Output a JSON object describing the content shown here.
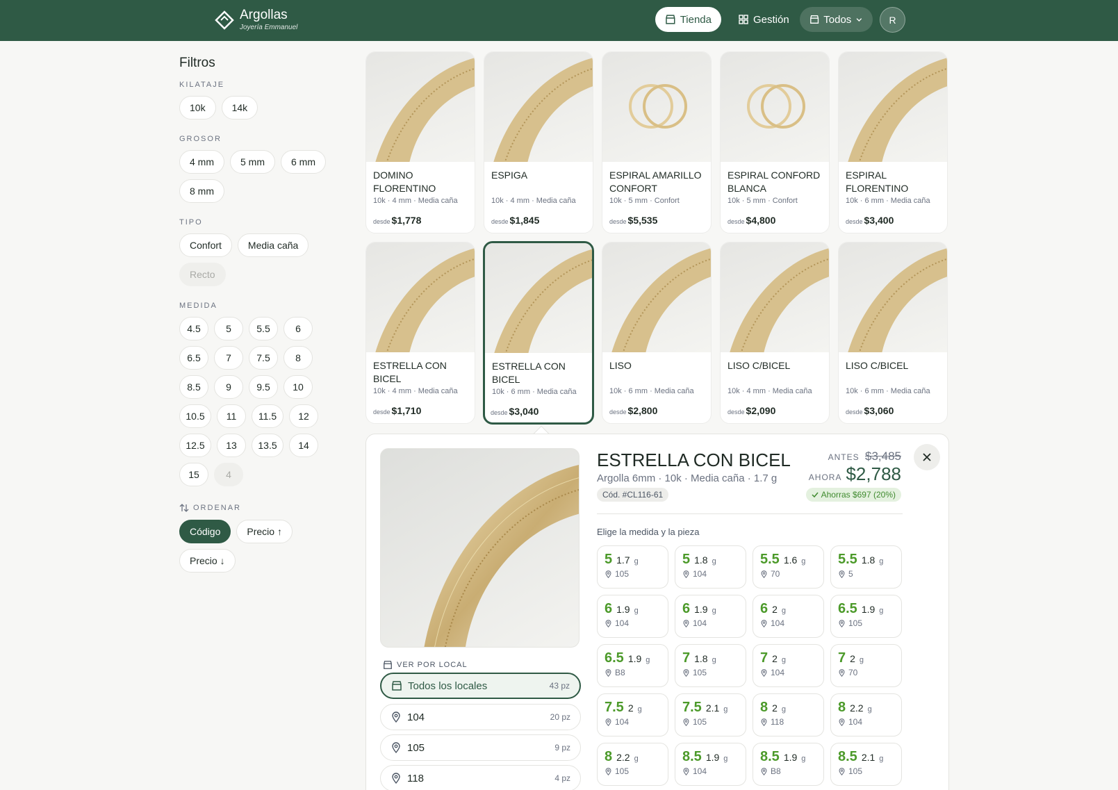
{
  "header": {
    "brand_title": "Argollas",
    "brand_subtitle": "Joyería Emmanuel",
    "nav_tienda": "Tienda",
    "nav_gestion": "Gestión",
    "nav_todos": "Todos",
    "avatar_initial": "R"
  },
  "sidebar": {
    "title": "Filtros",
    "kilataje_label": "KILATAJE",
    "kilataje": [
      "10k",
      "14k"
    ],
    "grosor_label": "GROSOR",
    "grosor": [
      "4 mm",
      "5 mm",
      "6 mm",
      "8 mm"
    ],
    "tipo_label": "TIPO",
    "tipo": [
      "Confort",
      "Media caña",
      "Recto"
    ],
    "medida_label": "MEDIDA",
    "medida": [
      "4.5",
      "5",
      "5.5",
      "6",
      "6.5",
      "7",
      "7.5",
      "8",
      "8.5",
      "9",
      "9.5",
      "10",
      "10.5",
      "11",
      "11.5",
      "12",
      "12.5",
      "13",
      "13.5",
      "14",
      "15",
      "4"
    ],
    "ordenar_label": "ORDENAR",
    "ordenar": [
      "Código",
      "Precio ↑",
      "Precio ↓"
    ]
  },
  "products": [
    {
      "name": "DOMINO FLORENTINO",
      "meta": "10k · 4 mm · Media caña",
      "desde": "desde",
      "price": "$1,778"
    },
    {
      "name": "ESPIGA",
      "meta": "10k · 4 mm · Media caña",
      "desde": "desde",
      "price": "$1,845"
    },
    {
      "name": "ESPIRAL AMARILLO CONFORT",
      "meta": "10k · 5 mm · Confort",
      "desde": "desde",
      "price": "$5,535"
    },
    {
      "name": "ESPIRAL CONFORD BLANCA",
      "meta": "10k · 5 mm · Confort",
      "desde": "desde",
      "price": "$4,800"
    },
    {
      "name": "ESPIRAL FLORENTINO",
      "meta": "10k · 6 mm · Media caña",
      "desde": "desde",
      "price": "$3,400"
    },
    {
      "name": "ESTRELLA CON BICEL",
      "meta": "10k · 4 mm · Media caña",
      "desde": "desde",
      "price": "$1,710"
    },
    {
      "name": "ESTRELLA CON BICEL",
      "meta": "10k · 6 mm · Media caña",
      "desde": "desde",
      "price": "$3,040"
    },
    {
      "name": "LISO",
      "meta": "10k · 6 mm · Media caña",
      "desde": "desde",
      "price": "$2,800"
    },
    {
      "name": "LISO C/BICEL",
      "meta": "10k · 4 mm · Media caña",
      "desde": "desde",
      "price": "$2,090"
    },
    {
      "name": "LISO C/BICEL",
      "meta": "10k · 6 mm · Media caña",
      "desde": "desde",
      "price": "$3,060"
    }
  ],
  "detail": {
    "title": "ESTRELLA CON BICEL",
    "subtitle": "Argolla 6mm · 10k · Media caña · 1.7 g",
    "code": "Cód. #CL116-61",
    "before_label": "ANTES",
    "before_price": "$3,485",
    "now_label": "AHORA",
    "now_price": "$2,788",
    "savings": "Ahorras $697 (20%)",
    "by_local_label": "VER POR LOCAL",
    "locals": [
      {
        "name": "Todos los locales",
        "count": "43 pz"
      },
      {
        "name": "104",
        "count": "20 pz"
      },
      {
        "name": "105",
        "count": "9 pz"
      },
      {
        "name": "118",
        "count": "4 pz"
      }
    ],
    "pick_label": "Elige la medida y la pieza",
    "weight_unit": "g",
    "pieces": [
      {
        "size": "5",
        "weight": "1.7",
        "loc": "105"
      },
      {
        "size": "5",
        "weight": "1.8",
        "loc": "104"
      },
      {
        "size": "5.5",
        "weight": "1.6",
        "loc": "70"
      },
      {
        "size": "5.5",
        "weight": "1.8",
        "loc": "5"
      },
      {
        "size": "6",
        "weight": "1.9",
        "loc": "104"
      },
      {
        "size": "6",
        "weight": "1.9",
        "loc": "104"
      },
      {
        "size": "6",
        "weight": "2",
        "loc": "104"
      },
      {
        "size": "6.5",
        "weight": "1.9",
        "loc": "105"
      },
      {
        "size": "6.5",
        "weight": "1.9",
        "loc": "B8"
      },
      {
        "size": "7",
        "weight": "1.8",
        "loc": "105"
      },
      {
        "size": "7",
        "weight": "2",
        "loc": "104"
      },
      {
        "size": "7",
        "weight": "2",
        "loc": "70"
      },
      {
        "size": "7.5",
        "weight": "2",
        "loc": "104"
      },
      {
        "size": "7.5",
        "weight": "2.1",
        "loc": "105"
      },
      {
        "size": "8",
        "weight": "2",
        "loc": "118"
      },
      {
        "size": "8",
        "weight": "2.2",
        "loc": "104"
      },
      {
        "size": "8",
        "weight": "2.2",
        "loc": "105"
      },
      {
        "size": "8.5",
        "weight": "1.9",
        "loc": "104"
      },
      {
        "size": "8.5",
        "weight": "1.9",
        "loc": "B8"
      },
      {
        "size": "8.5",
        "weight": "2.1",
        "loc": "105"
      }
    ]
  },
  "colors": {
    "brand": "#2f5a45",
    "size_green": "#4c9a2a",
    "savings_bg": "#e4f1df"
  }
}
